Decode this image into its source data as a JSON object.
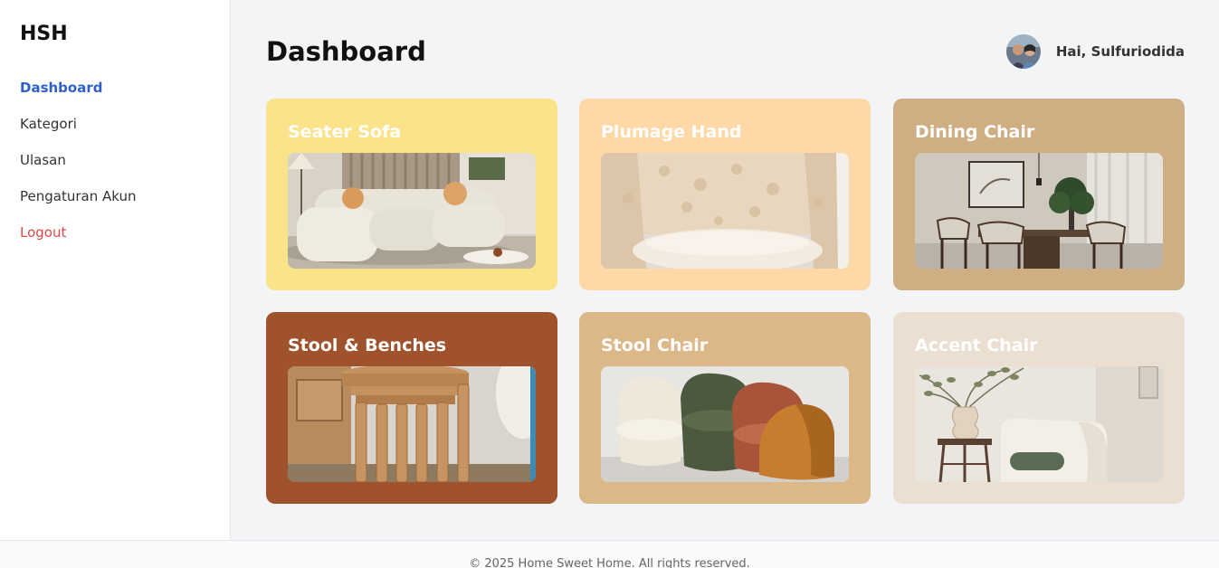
{
  "brand": "HSH",
  "nav": {
    "items": [
      {
        "label": "Dashboard",
        "active": true
      },
      {
        "label": "Kategori"
      },
      {
        "label": "Ulasan"
      },
      {
        "label": "Pengaturan Akun"
      },
      {
        "label": "Logout"
      }
    ]
  },
  "header": {
    "title": "Dashboard",
    "greeting": "Hai, Sulfuriodida"
  },
  "categories": [
    {
      "title": "Seater Sofa",
      "color": "#fbe38a",
      "image": "sofa"
    },
    {
      "title": "Plumage Hand",
      "color": "#ffd8a8",
      "image": "plumage-chair"
    },
    {
      "title": "Dining Chair",
      "color": "#cfae83",
      "image": "dining-room"
    },
    {
      "title": "Stool & Benches",
      "color": "#a0522d",
      "image": "stools"
    },
    {
      "title": "Stool Chair",
      "color": "#dcb888",
      "image": "velvet-chairs"
    },
    {
      "title": "Accent Chair",
      "color": "#ebdfd2",
      "image": "accent-chair"
    }
  ],
  "footer": "© 2025 Home Sweet Home. All rights reserved.",
  "colors": {
    "accent": "#2f5fc9",
    "logout": "#d94a4a",
    "background": "#f3f4f6"
  }
}
